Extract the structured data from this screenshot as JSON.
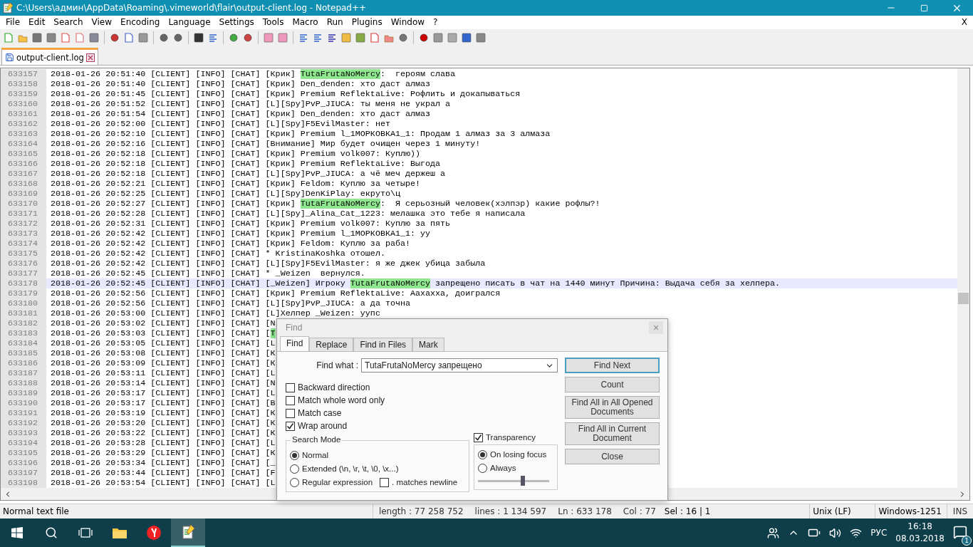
{
  "window": {
    "title": "C:\\Users\\админ\\AppData\\Roaming\\.vimeworld\\flair\\output-client.log - Notepad++"
  },
  "menu": [
    "File",
    "Edit",
    "Search",
    "View",
    "Encoding",
    "Language",
    "Settings",
    "Tools",
    "Macro",
    "Run",
    "Plugins",
    "Window",
    "?"
  ],
  "menu_close": "X",
  "tabs": [
    {
      "label": "output-client.log",
      "selected": true
    }
  ],
  "editor": {
    "lines": [
      {
        "number": "633157",
        "current": false,
        "parts": [
          {
            "text": "2018-01-26 20:51:40 [CLIENT] [INFO] [CHAT] [Крик] ",
            "marked": false
          },
          {
            "text": "TutaFrutaNoMercy",
            "marked": true
          },
          {
            "text": ":  героям слава",
            "marked": false
          }
        ]
      },
      {
        "number": "633158",
        "current": false,
        "parts": [
          {
            "text": "2018-01-26 20:51:40 [CLIENT] [INFO] [CHAT] [Крик] Den_denden: хто даст алмаз",
            "marked": false
          }
        ]
      },
      {
        "number": "633159",
        "current": false,
        "parts": [
          {
            "text": "2018-01-26 20:51:45 [CLIENT] [INFO] [CHAT] [Крик] Premium ReflektaLive: Рофлить и докапываться",
            "marked": false
          }
        ]
      },
      {
        "number": "633160",
        "current": false,
        "parts": [
          {
            "text": "2018-01-26 20:51:52 [CLIENT] [INFO] [CHAT] [L][Spy]PvP_JIUCA: ты меня не украл а",
            "marked": false
          }
        ]
      },
      {
        "number": "633161",
        "current": false,
        "parts": [
          {
            "text": "2018-01-26 20:51:54 [CLIENT] [INFO] [CHAT] [Крик] Den_denden: хто даст алмаз",
            "marked": false
          }
        ]
      },
      {
        "number": "633162",
        "current": false,
        "parts": [
          {
            "text": "2018-01-26 20:52:00 [CLIENT] [INFO] [CHAT] [L][Spy]F5EvilMaster: нет",
            "marked": false
          }
        ]
      },
      {
        "number": "633163",
        "current": false,
        "parts": [
          {
            "text": "2018-01-26 20:52:10 [CLIENT] [INFO] [CHAT] [Крик] Premium l_1МОРКОВКА1_1: Продам 1 алмаз за 3 алмаза",
            "marked": false
          }
        ]
      },
      {
        "number": "633164",
        "current": false,
        "parts": [
          {
            "text": "2018-01-26 20:52:16 [CLIENT] [INFO] [CHAT] [Внимание] Мир будет очищен через 1 минуту!",
            "marked": false
          }
        ]
      },
      {
        "number": "633165",
        "current": false,
        "parts": [
          {
            "text": "2018-01-26 20:52:18 [CLIENT] [INFO] [CHAT] [Крик] Premium volk007: Куплю))",
            "marked": false
          }
        ]
      },
      {
        "number": "633166",
        "current": false,
        "parts": [
          {
            "text": "2018-01-26 20:52:18 [CLIENT] [INFO] [CHAT] [Крик] Premium ReflektaLive: Выгода",
            "marked": false
          }
        ]
      },
      {
        "number": "633167",
        "current": false,
        "parts": [
          {
            "text": "2018-01-26 20:52:18 [CLIENT] [INFO] [CHAT] [L][Spy]PvP_JIUCA: а чё меч держеш а",
            "marked": false
          }
        ]
      },
      {
        "number": "633168",
        "current": false,
        "parts": [
          {
            "text": "2018-01-26 20:52:21 [CLIENT] [INFO] [CHAT] [Крик] Feldom: Куплю за четыре!",
            "marked": false
          }
        ]
      },
      {
        "number": "633169",
        "current": false,
        "parts": [
          {
            "text": "2018-01-26 20:52:25 [CLIENT] [INFO] [CHAT] [L][Spy]DenKiPlay: екруто\\ц",
            "marked": false
          }
        ]
      },
      {
        "number": "633170",
        "current": false,
        "parts": [
          {
            "text": "2018-01-26 20:52:27 [CLIENT] [INFO] [CHAT] [Крик] ",
            "marked": false
          },
          {
            "text": "TutaFrutaNoMercy",
            "marked": true
          },
          {
            "text": ":  Я серьозный человек(хэлпэр) какие рофлы?!",
            "marked": false
          }
        ]
      },
      {
        "number": "633171",
        "current": false,
        "parts": [
          {
            "text": "2018-01-26 20:52:28 [CLIENT] [INFO] [CHAT] [L][Spy]_Alina_Cat_1223: мелашка это тебе я написала",
            "marked": false
          }
        ]
      },
      {
        "number": "633172",
        "current": false,
        "parts": [
          {
            "text": "2018-01-26 20:52:31 [CLIENT] [INFO] [CHAT] [Крик] Premium volk007: Куплю за пять",
            "marked": false
          }
        ]
      },
      {
        "number": "633173",
        "current": false,
        "parts": [
          {
            "text": "2018-01-26 20:52:42 [CLIENT] [INFO] [CHAT] [Крик] Premium l_1МОРКОВКА1_1: уу",
            "marked": false
          }
        ]
      },
      {
        "number": "633174",
        "current": false,
        "parts": [
          {
            "text": "2018-01-26 20:52:42 [CLIENT] [INFO] [CHAT] [Крик] Feldom: Куплю за раба!",
            "marked": false
          }
        ]
      },
      {
        "number": "633175",
        "current": false,
        "parts": [
          {
            "text": "2018-01-26 20:52:42 [CLIENT] [INFO] [CHAT] * KristinaKoshka отошел.",
            "marked": false
          }
        ]
      },
      {
        "number": "633176",
        "current": false,
        "parts": [
          {
            "text": "2018-01-26 20:52:42 [CLIENT] [INFO] [CHAT] [L][Spy]F5EvilMaster: я же джек убица забыла",
            "marked": false
          }
        ]
      },
      {
        "number": "633177",
        "current": false,
        "parts": [
          {
            "text": "2018-01-26 20:52:45 [CLIENT] [INFO] [CHAT] * _Weizen  вернулся.",
            "marked": false
          }
        ]
      },
      {
        "number": "633178",
        "current": true,
        "parts": [
          {
            "text": "2018-01-26 20:52:45 [CLIENT] [INFO] [CHAT] [_Weizen] Игроку ",
            "marked": false
          },
          {
            "text": "TutaFrutaNoMercy",
            "marked": true
          },
          {
            "text": " запрещено писать в чат на 1440 минут Причина: Выдача себя за хелпера.",
            "marked": false
          }
        ]
      },
      {
        "number": "633179",
        "current": false,
        "parts": [
          {
            "text": "2018-01-26 20:52:56 [CLIENT] [INFO] [CHAT] [Крик] Premium ReflektaLive: Аахахха, доигрался",
            "marked": false
          }
        ]
      },
      {
        "number": "633180",
        "current": false,
        "parts": [
          {
            "text": "2018-01-26 20:52:56 [CLIENT] [INFO] [CHAT] [L][Spy]PvP_JIUCA: а да точна",
            "marked": false
          }
        ]
      },
      {
        "number": "633181",
        "current": false,
        "parts": [
          {
            "text": "2018-01-26 20:53:00 [CLIENT] [INFO] [CHAT] [L]Хелпер _Weizen: уупс",
            "marked": false
          }
        ]
      },
      {
        "number": "633182",
        "current": false,
        "parts": [
          {
            "text": "2018-01-26 20:53:02 [CLIENT] [INFO] [CHAT] [N",
            "marked": false
          }
        ]
      },
      {
        "number": "633183",
        "current": false,
        "parts": [
          {
            "text": "2018-01-26 20:53:03 [CLIENT] [INFO] [CHAT] [",
            "marked": false
          },
          {
            "text": "T",
            "marked": true
          }
        ]
      },
      {
        "number": "633184",
        "current": false,
        "parts": [
          {
            "text": "2018-01-26 20:53:05 [CLIENT] [INFO] [CHAT] [L",
            "marked": false
          }
        ]
      },
      {
        "number": "633185",
        "current": false,
        "parts": [
          {
            "text": "2018-01-26 20:53:08 [CLIENT] [INFO] [CHAT] [К",
            "marked": false
          }
        ]
      },
      {
        "number": "633186",
        "current": false,
        "parts": [
          {
            "text": "2018-01-26 20:53:09 [CLIENT] [INFO] [CHAT] [К",
            "marked": false
          }
        ]
      },
      {
        "number": "633187",
        "current": false,
        "parts": [
          {
            "text": "2018-01-26 20:53:11 [CLIENT] [INFO] [CHAT] [L",
            "marked": false
          }
        ]
      },
      {
        "number": "633188",
        "current": false,
        "parts": [
          {
            "text": "2018-01-26 20:53:14 [CLIENT] [INFO] [CHAT] [N",
            "marked": false
          }
        ]
      },
      {
        "number": "633189",
        "current": false,
        "parts": [
          {
            "text": "2018-01-26 20:53:17 [CLIENT] [INFO] [CHAT] [L",
            "marked": false
          }
        ]
      },
      {
        "number": "633190",
        "current": false,
        "parts": [
          {
            "text": "2018-01-26 20:53:17 [CLIENT] [INFO] [CHAT] [В",
            "marked": false
          }
        ]
      },
      {
        "number": "633191",
        "current": false,
        "parts": [
          {
            "text": "2018-01-26 20:53:19 [CLIENT] [INFO] [CHAT] [К",
            "marked": false
          }
        ]
      },
      {
        "number": "633192",
        "current": false,
        "parts": [
          {
            "text": "2018-01-26 20:53:20 [CLIENT] [INFO] [CHAT] [К",
            "marked": false
          }
        ]
      },
      {
        "number": "633193",
        "current": false,
        "parts": [
          {
            "text": "2018-01-26 20:53:22 [CLIENT] [INFO] [CHAT] [К",
            "marked": false
          }
        ]
      },
      {
        "number": "633194",
        "current": false,
        "parts": [
          {
            "text": "2018-01-26 20:53:28 [CLIENT] [INFO] [CHAT] [L",
            "marked": false
          }
        ]
      },
      {
        "number": "633195",
        "current": false,
        "parts": [
          {
            "text": "2018-01-26 20:53:29 [CLIENT] [INFO] [CHAT] [К",
            "marked": false
          }
        ]
      },
      {
        "number": "633196",
        "current": false,
        "parts": [
          {
            "text": "2018-01-26 20:53:34 [CLIENT] [INFO] [CHAT] [_",
            "marked": false
          }
        ]
      },
      {
        "number": "633197",
        "current": false,
        "parts": [
          {
            "text": "2018-01-26 20:53:44 [CLIENT] [INFO] [CHAT] [F",
            "marked": false
          }
        ]
      },
      {
        "number": "633198",
        "current": false,
        "parts": [
          {
            "text": "2018-01-26 20:53:54 [CLIENT] [INFO] [CHAT] [L",
            "marked": false
          }
        ]
      }
    ]
  },
  "find_dialog": {
    "title": "Find",
    "close": "×",
    "tabs": [
      {
        "label": "Find",
        "selected": true
      },
      {
        "label": "Replace",
        "selected": false
      },
      {
        "label": "Find in Files",
        "selected": false
      },
      {
        "label": "Mark",
        "selected": false
      }
    ],
    "find_what": {
      "label": "Find what :",
      "value": "TutaFrutaNoMercy запрещено"
    },
    "buttons": [
      {
        "label": "Find Next",
        "default": true
      },
      {
        "label": "Count",
        "default": false
      },
      {
        "label": "Find All in All Opened Documents",
        "default": false
      },
      {
        "label": "Find All in Current Document",
        "default": false
      },
      {
        "label": "Close",
        "default": false
      }
    ],
    "options": [
      {
        "label": "Backward direction",
        "checked": false
      },
      {
        "label": "Match whole word only",
        "checked": false
      },
      {
        "label": "Match case",
        "checked": false
      },
      {
        "label": "Wrap around",
        "checked": true
      }
    ],
    "search_mode": {
      "title": "Search Mode",
      "modes": [
        {
          "label": "Normal",
          "selected": true
        },
        {
          "label": "Extended (\\n, \\r, \\t, \\0, \\x...)",
          "selected": false
        },
        {
          "label": "Regular expression",
          "selected": false
        }
      ],
      "newline": {
        "label": ". matches newline",
        "checked": false
      }
    },
    "transparency": {
      "label": "Transparency",
      "checked": true,
      "modes": [
        {
          "label": "On losing focus",
          "selected": true
        },
        {
          "label": "Always",
          "selected": false
        }
      ],
      "level": 0.63
    }
  },
  "status_bar": {
    "type": "Normal text file",
    "length": "length : 77 258 752",
    "lines": "lines : 1 134 597",
    "position": "Ln : 633 178",
    "col": "Col : 77",
    "sel": "Sel : 16 | 1",
    "eol": "Unix (LF)",
    "encoding": "Windows-1251",
    "mode": "INS"
  },
  "taskbar": {
    "language": "РУС",
    "time": "16:18",
    "date": "08.03.2018",
    "notifications": "1"
  }
}
